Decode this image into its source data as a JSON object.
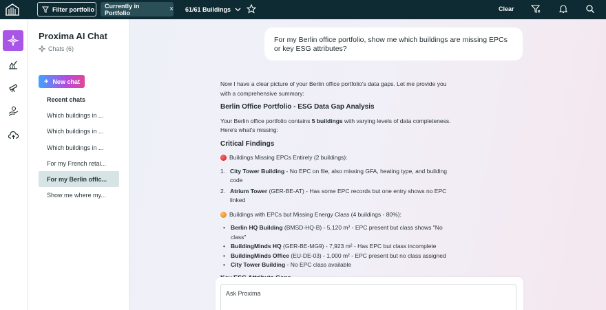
{
  "topbar": {
    "filter_label": "Filter portfolio",
    "chip_label": "Currently in Portfolio",
    "chip_close": "×",
    "buildings_label": "61/61 Buildings",
    "clear_label": "Clear",
    "icons": [
      "app-logo-icon",
      "filter-icon",
      "chevron-down-icon",
      "star-icon",
      "filter-clear-icon",
      "bell-icon",
      "search-icon"
    ]
  },
  "rail": {
    "items": [
      "ai-chat-icon",
      "analytics-icon",
      "telescope-icon",
      "hand-coin-icon",
      "cloud-upload-icon"
    ]
  },
  "sidebar": {
    "title": "Proxima AI Chat",
    "chats_label": "Chats (6)",
    "new_chat_label": "New chat",
    "recent_label": "Recent chats",
    "chats": [
      "Which buildings in ...",
      "Which buildings in ...",
      "Which buildings in ...",
      "For my French retai...",
      "For my Berlin offic...",
      "Show me where my..."
    ]
  },
  "conversation": {
    "user_message": "For my Berlin office portfolio, show me which buildings are missing EPCs or key ESG attributes?",
    "intro": "Now I have a clear picture of your Berlin office portfolio's data gaps. Let me provide you with a comprehensive summary:",
    "heading": "Berlin Office Portfolio - ESG Data Gap Analysis",
    "summary_pre": "Your Berlin office portfolio contains ",
    "summary_bold": "5 buildings",
    "summary_post": " with varying levels of data completeness. Here's what's missing:",
    "critical_heading": "Critical Findings",
    "missing_epc_heading": "Buildings Missing EPCs Entirely (2 buildings):",
    "missing_epc": [
      {
        "num": "1.",
        "name": "City Tower Building",
        "text": " - No EPC on file, also missing GFA, heating type, and building code"
      },
      {
        "num": "2.",
        "name": "Atrium Tower",
        "text": " (GER-BE-AT) - Has some EPC records but one entry shows no EPC linked"
      }
    ],
    "missing_class_heading": "Buildings with EPCs but Missing Energy Class (4 buildings - 80%):",
    "missing_class": [
      {
        "name": "Berlin HQ Building",
        "text": " (BMSD-HQ-B) - 5,120 m² - EPC present but class shows \"No class\""
      },
      {
        "name": "BuildingMinds HQ",
        "text": " (GER-BE-MG9) - 7,923 m² - Has EPC but class incomplete"
      },
      {
        "name": "BuildingMinds Office",
        "text": " (EU-DE-03) - 1,000 m² - EPC present but no class assigned"
      },
      {
        "name": "City Tower Building",
        "text": " - No EPC class available"
      }
    ],
    "next_heading_peek": "Key ESG Attribute Gaps"
  },
  "input": {
    "placeholder": "Ask Proxima"
  },
  "colors": {
    "topbar": "#0e2b33",
    "accent_purple": "#a855e8",
    "active_chat_bg": "#d6e4e6"
  }
}
